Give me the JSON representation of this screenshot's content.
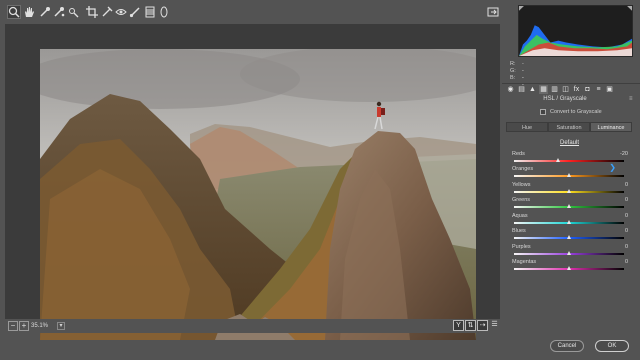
{
  "toolbar": {
    "tools": [
      "zoom-icon",
      "hand-icon",
      "white-balance-icon",
      "color-sampler-icon",
      "targeted-adjustment-icon",
      "crop-icon",
      "spot-removal-icon",
      "red-eye-icon",
      "adjustment-brush-icon",
      "graduated-filter-icon",
      "radial-filter-icon"
    ],
    "open_preferences_icon": "preferences-icon"
  },
  "status": {
    "zoom": "35.1%"
  },
  "histogram": {
    "r_label": "R:",
    "r_value": "---",
    "g_label": "G:",
    "g_value": "---",
    "b_label": "B:",
    "b_value": "---"
  },
  "panel": {
    "title": "HSL / Grayscale",
    "convert_label": "Convert to Grayscale",
    "tabs": [
      "Hue",
      "Saturation",
      "Luminance"
    ],
    "selected_tab": "Luminance",
    "default_label": "Default",
    "sliders": [
      {
        "label": "Reds",
        "value": "-20",
        "position": 0.4
      },
      {
        "label": "Oranges",
        "value": "",
        "position": 0.5
      },
      {
        "label": "Yellows",
        "value": "0",
        "position": 0.5
      },
      {
        "label": "Greens",
        "value": "0",
        "position": 0.5
      },
      {
        "label": "Aquas",
        "value": "0",
        "position": 0.5
      },
      {
        "label": "Blues",
        "value": "0",
        "position": 0.5
      },
      {
        "label": "Purples",
        "value": "0",
        "position": 0.5
      },
      {
        "label": "Magentas",
        "value": "0",
        "position": 0.5
      }
    ]
  },
  "buttons": {
    "cancel": "Cancel",
    "ok": "OK"
  }
}
